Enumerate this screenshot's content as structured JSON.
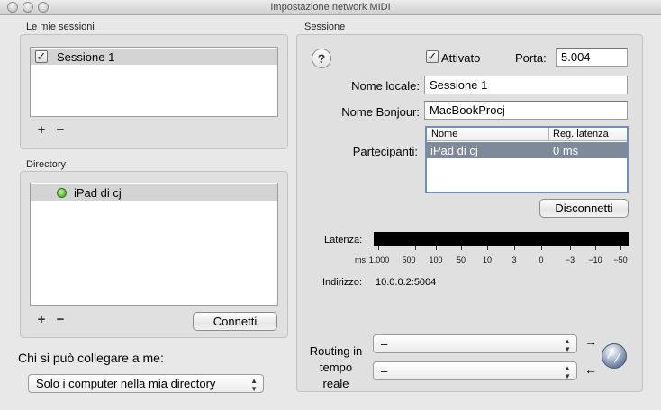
{
  "window": {
    "title": "Impostazione network MIDI"
  },
  "sessions": {
    "heading": "Le mie sessioni",
    "items": [
      {
        "label": "Sessione 1",
        "checked": true
      }
    ],
    "add_label": "+",
    "remove_label": "−"
  },
  "directory": {
    "heading": "Directory",
    "items": [
      {
        "label": "iPad di cj",
        "status_color": "#4caf2a"
      }
    ],
    "add_label": "+",
    "remove_label": "−",
    "connect_label": "Connetti"
  },
  "who_can_connect": {
    "label": "Chi si può collegare a me:",
    "selected": "Solo i computer nella mia directory"
  },
  "session": {
    "heading": "Sessione",
    "help_label": "?",
    "enabled_label": "Attivato",
    "enabled": true,
    "port_label": "Porta:",
    "port_value": "5.004",
    "local_name_label": "Nome locale:",
    "local_name_value": "Sessione 1",
    "bonjour_name_label": "Nome Bonjour:",
    "bonjour_name_value": "MacBookProcj",
    "participants_label": "Partecipanti:",
    "participants_columns": [
      "Nome",
      "Reg. latenza"
    ],
    "participants": [
      {
        "name": "iPad di cj",
        "latency": "0 ms"
      }
    ],
    "disconnect_label": "Disconnetti",
    "latency_label": "Latenza:",
    "latency_unit": "ms",
    "latency_ticks": [
      "1.000",
      "500",
      "100",
      "50",
      "10",
      "3",
      "0",
      "−3",
      "−10",
      "−50"
    ],
    "address_label": "Indirizzo:",
    "address_value": "10.0.0.2:5004",
    "routing_label_line1": "Routing in",
    "routing_label_line2": "tempo reale",
    "routing_in_value": "–",
    "routing_out_value": "–",
    "arrow_right": "→",
    "arrow_left": "←"
  }
}
